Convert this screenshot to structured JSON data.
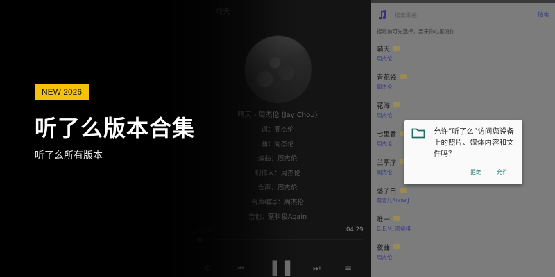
{
  "overlay": {
    "badge": "NEW 2026",
    "headline": "听了么版本合集",
    "subhead": "听了么所有版本"
  },
  "player": {
    "title": "晴天",
    "song_line": "晴天 - 周杰伦 (Jay Chou)",
    "credits": [
      "词：周杰伦",
      "曲：周杰伦",
      "编曲：周杰伦",
      "制作人：周杰伦",
      "合声：周杰伦",
      "合声编写：周杰伦",
      "吉他：蔡科俊Again"
    ],
    "time_elapsed": "00:00",
    "time_total": "04:29",
    "progress": 0
  },
  "list_screen": {
    "search_placeholder": "搜索歌曲...",
    "search_button": "搜索",
    "hint": "搜歌前可先选择，要来你心里没你",
    "songs": [
      {
        "title": "晴天",
        "artist": "周杰伦"
      },
      {
        "title": "青花瓷",
        "artist": "周杰伦"
      },
      {
        "title": "花海",
        "artist": "周杰伦"
      },
      {
        "title": "七里香",
        "artist": "周杰伦"
      },
      {
        "title": "兰亭序",
        "artist": "周杰伦"
      },
      {
        "title": "落了白",
        "artist": "蒋雪儿Snow.J"
      },
      {
        "title": "唯一",
        "artist": "G.E.M. 邓紫棋"
      },
      {
        "title": "夜曲",
        "artist": "周杰伦"
      }
    ]
  },
  "dialog": {
    "message": "允许“听了么”访问您设备上的照片、媒体内容和文件吗？",
    "deny": "拒绝",
    "allow": "允许"
  },
  "colors": {
    "badge_bg": "#f4c20d",
    "accent_purple": "#3c3c80",
    "dialog_button": "#1b7a6b"
  }
}
